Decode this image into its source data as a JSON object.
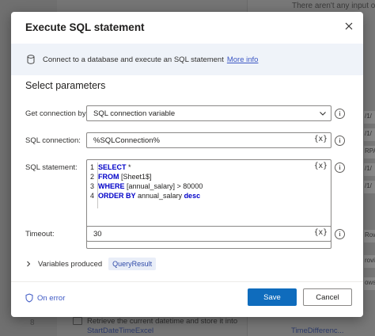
{
  "background": {
    "top_right_text": "There aren't any input or",
    "step_number": "8",
    "step_text": "Retrieve the current datetime and store it into",
    "step_var": "StartDateTimeExcel",
    "var_panel_text": "TimeDifferenc..."
  },
  "dialog": {
    "title": "Execute SQL statement",
    "banner": {
      "text": "Connect to a database and execute an SQL statement",
      "link": "More info"
    },
    "section_title": "Select parameters",
    "fields": {
      "connection_by": {
        "label": "Get connection by:",
        "value": "SQL connection variable"
      },
      "sql_connection": {
        "label": "SQL connection:",
        "value": "%SQLConnection%",
        "var_button": "{x}"
      },
      "sql_statement": {
        "label": "SQL statement:",
        "var_button": "{x}",
        "lines": [
          {
            "num": "1",
            "keyword": "SELECT",
            "rest": " *"
          },
          {
            "num": "2",
            "keyword": "FROM",
            "rest": " [Sheet1$]"
          },
          {
            "num": "3",
            "keyword": "WHERE",
            "rest": " [annual_salary] > 80000"
          },
          {
            "num": "4",
            "keyword": "ORDER BY",
            "rest": " annual_salary ",
            "keyword2": "desc"
          }
        ]
      },
      "timeout": {
        "label": "Timeout:",
        "value": "30",
        "var_button": "{x}"
      }
    },
    "variables_produced": {
      "label": "Variables produced",
      "chip": "QueryResult"
    },
    "footer": {
      "on_error": "On error",
      "save": "Save",
      "cancel": "Cancel"
    }
  },
  "colors": {
    "primary": "#0f6cbd",
    "link": "#3d58c4",
    "banner_bg": "#eff3f9",
    "sql_keyword": "#0000c8"
  }
}
